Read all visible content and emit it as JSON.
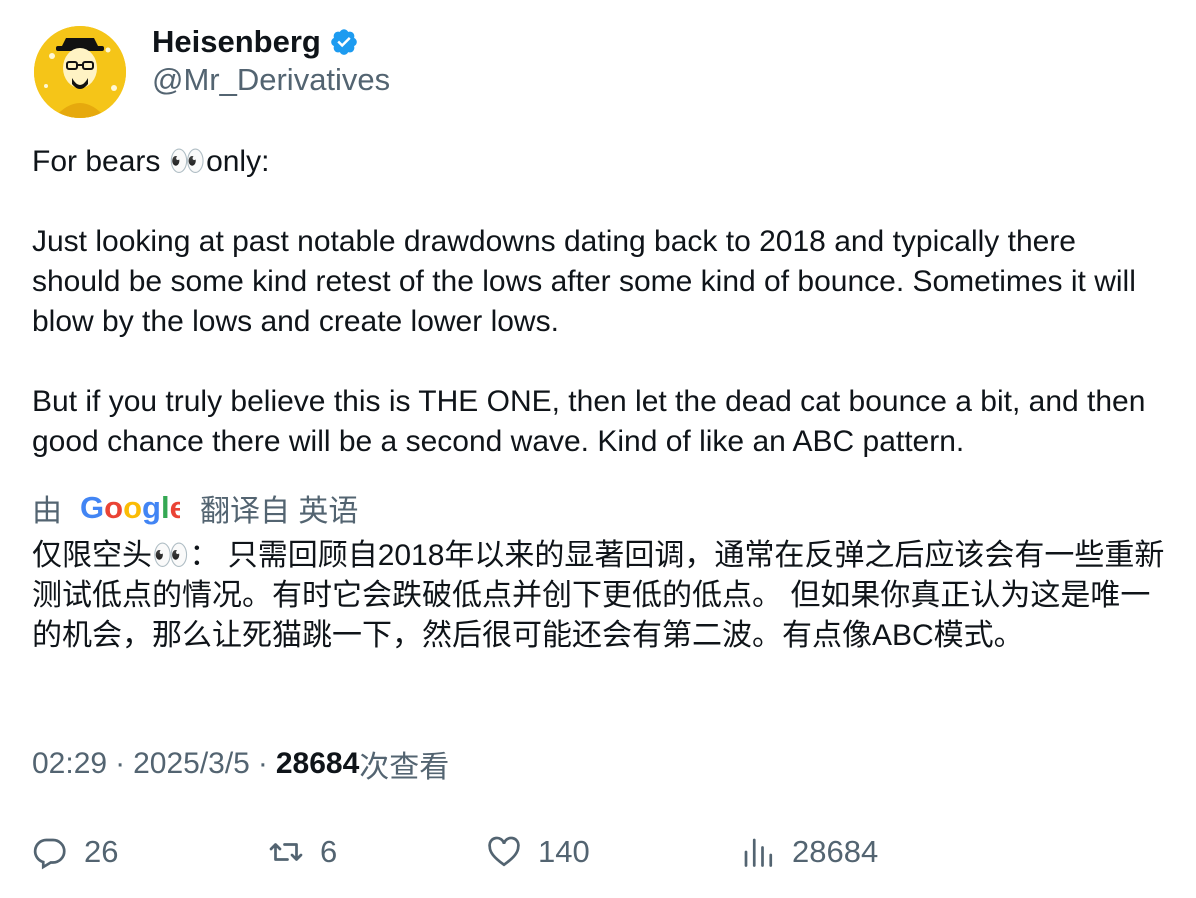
{
  "author": {
    "name": "Heisenberg",
    "handle": "@Mr_Derivatives",
    "verified_color": "#1d9bf0"
  },
  "tweet": {
    "paragraphs": [
      "For bears 👀only:",
      "Just looking at past notable drawdowns dating back to 2018 and typically there should be some kind retest of the lows after some kind of bounce. Sometimes it will blow by the lows and create lower lows.",
      "But if you truly believe this is THE ONE, then let the dead cat bounce a bit, and then good chance there will be a second wave. Kind of like an ABC pattern."
    ]
  },
  "translation": {
    "prefix": "由",
    "provider_logo_text": "Google",
    "suffix": "翻译自 英语",
    "text": "仅限空头👀： 只需回顾自2018年以来的显著回调，通常在反弹之后应该会有一些重新测试低点的情况。有时它会跌破低点并创下更低的低点。 但如果你真正认为这是唯一的机会，那么让死猫跳一下，然后很可能还会有第二波。有点像ABC模式。"
  },
  "meta": {
    "time": "02:29",
    "separator": "·",
    "date": "2025/3/5",
    "views_count": "28684",
    "views_suffix": "次查看"
  },
  "actions": {
    "replies": "26",
    "retweets": "6",
    "likes": "140",
    "views": "28684"
  },
  "colors": {
    "text": "#0f1419",
    "secondary": "#536471",
    "avatar_bg": "#f3c21b"
  }
}
